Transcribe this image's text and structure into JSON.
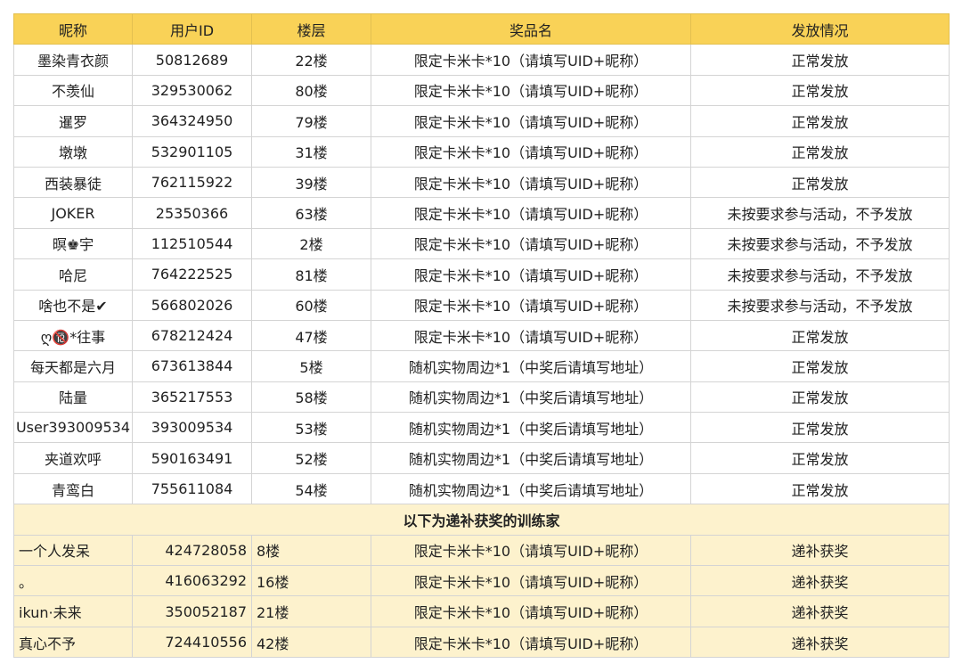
{
  "headers": [
    "昵称",
    "用户ID",
    "楼层",
    "奖品名",
    "发放情况"
  ],
  "rows": [
    [
      "墨染青衣颜",
      "50812689",
      "22楼",
      "限定卡米卡*10（请填写UID+昵称）",
      "正常发放"
    ],
    [
      "不羡仙",
      "329530062",
      "80楼",
      "限定卡米卡*10（请填写UID+昵称）",
      "正常发放"
    ],
    [
      "暹罗",
      "364324950",
      "79楼",
      "限定卡米卡*10（请填写UID+昵称）",
      "正常发放"
    ],
    [
      "墩墩",
      "532901105",
      "31楼",
      "限定卡米卡*10（请填写UID+昵称）",
      "正常发放"
    ],
    [
      "西装暴徒",
      "762115922",
      "39楼",
      "限定卡米卡*10（请填写UID+昵称）",
      "正常发放"
    ],
    [
      "JOKER",
      "25350366",
      "63楼",
      "限定卡米卡*10（请填写UID+昵称）",
      "未按要求参与活动，不予发放"
    ],
    [
      "暝♚宇",
      "112510544",
      "2楼",
      "限定卡米卡*10（请填写UID+昵称）",
      "未按要求参与活动，不予发放"
    ],
    [
      "哈尼",
      "764222525",
      "81楼",
      "限定卡米卡*10（请填写UID+昵称）",
      "未按要求参与活动，不予发放"
    ],
    [
      "啥也不是✔",
      "566802026",
      "60楼",
      "限定卡米卡*10（请填写UID+昵称）",
      "未按要求参与活动，不予发放"
    ],
    [
      "ღ🔞*往事",
      "678212424",
      "47楼",
      "限定卡米卡*10（请填写UID+昵称）",
      "正常发放"
    ],
    [
      "每天都是六月",
      "673613844",
      "5楼",
      "随机实物周边*1（中奖后请填写地址）",
      "正常发放"
    ],
    [
      "陆量",
      "365217553",
      "58楼",
      "随机实物周边*1（中奖后请填写地址）",
      "正常发放"
    ],
    [
      "User393009534",
      "393009534",
      "53楼",
      "随机实物周边*1（中奖后请填写地址）",
      "正常发放"
    ],
    [
      "夹道欢呼",
      "590163491",
      "52楼",
      "随机实物周边*1（中奖后请填写地址）",
      "正常发放"
    ],
    [
      "青鸾白",
      "755611084",
      "54楼",
      "随机实物周边*1（中奖后请填写地址）",
      "正常发放"
    ]
  ],
  "banner": "以下为递补获奖的训练家",
  "sub_rows": [
    [
      "一个人发呆",
      "424728058",
      "8楼",
      "限定卡米卡*10（请填写UID+昵称）",
      "递补获奖"
    ],
    [
      "。",
      "416063292",
      "16楼",
      "限定卡米卡*10（请填写UID+昵称）",
      "递补获奖"
    ],
    [
      "ikun·未来",
      "350052187",
      "21楼",
      "限定卡米卡*10（请填写UID+昵称）",
      "递补获奖"
    ],
    [
      "真心不予",
      "724410556",
      "42楼",
      "限定卡米卡*10（请填写UID+昵称）",
      "递补获奖"
    ]
  ],
  "colors": {
    "header_bg": "#f9d257",
    "sub_bg": "#fdf2cd"
  }
}
